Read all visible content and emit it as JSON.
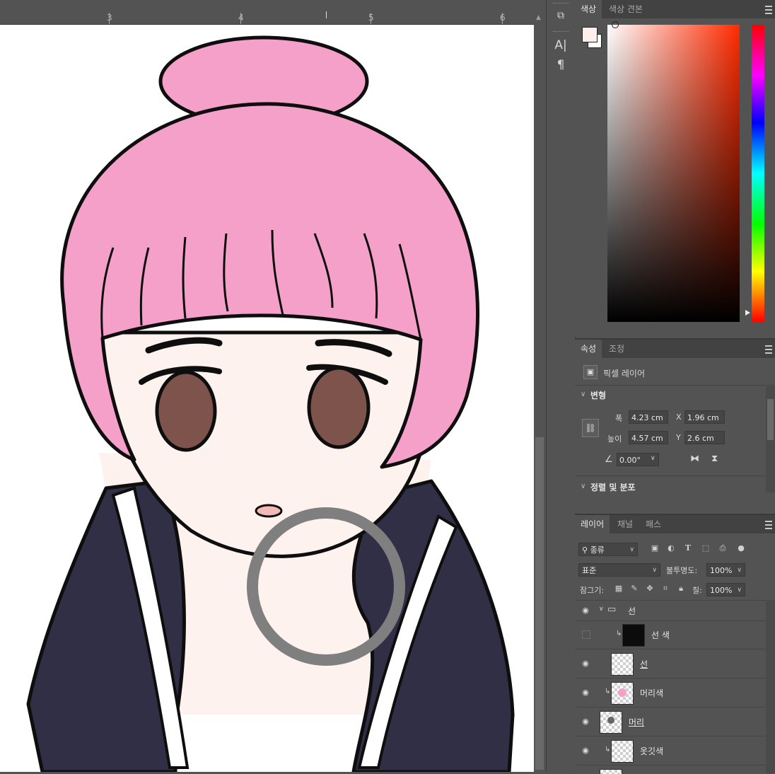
{
  "ruler": {
    "marks": [
      "3",
      "4",
      "5",
      "6"
    ]
  },
  "color_panel": {
    "tabs": [
      "색상",
      "색상 견본"
    ],
    "foreground_color": "#fdf0ec",
    "background_color": "#ffffff"
  },
  "properties_panel": {
    "tabs": [
      "속성",
      "조정"
    ],
    "layer_type": "픽셀 레이어",
    "transform_title": "변형",
    "width_label": "폭",
    "width_value": "4.23 cm",
    "height_label": "높이",
    "height_value": "4.57 cm",
    "x_label": "X",
    "x_value": "1.96 cm",
    "y_label": "Y",
    "y_value": "2.6 cm",
    "angle_value": "0.00°",
    "align_title": "정렬 및 분포"
  },
  "layers_panel": {
    "tabs": [
      "레이어",
      "채널",
      "패스"
    ],
    "filter_kind": "종류",
    "blend_mode": "표준",
    "opacity_label": "불투명도:",
    "opacity_value": "100%",
    "lock_label": "잠그기:",
    "fill_label": "칠:",
    "fill_value": "100%",
    "layers": [
      {
        "name": "선",
        "type": "group",
        "visible": true
      },
      {
        "name": "선 색",
        "type": "pixel",
        "visible": false,
        "clipped": true
      },
      {
        "name": "선",
        "type": "pixel",
        "visible": true
      },
      {
        "name": "머리색",
        "type": "pixel",
        "visible": true,
        "clipped": true
      },
      {
        "name": "머리",
        "type": "pixel",
        "visible": true
      },
      {
        "name": "옷깃색",
        "type": "pixel",
        "visible": true,
        "clipped": true
      }
    ]
  },
  "colors": {
    "hair": "#f4a0c8",
    "skin": "#fef2ef",
    "eyes": "#7d534c",
    "jacket": "#312f45",
    "outline": "#0e0e0e",
    "magnifier_ring": "#7f7f7f"
  }
}
